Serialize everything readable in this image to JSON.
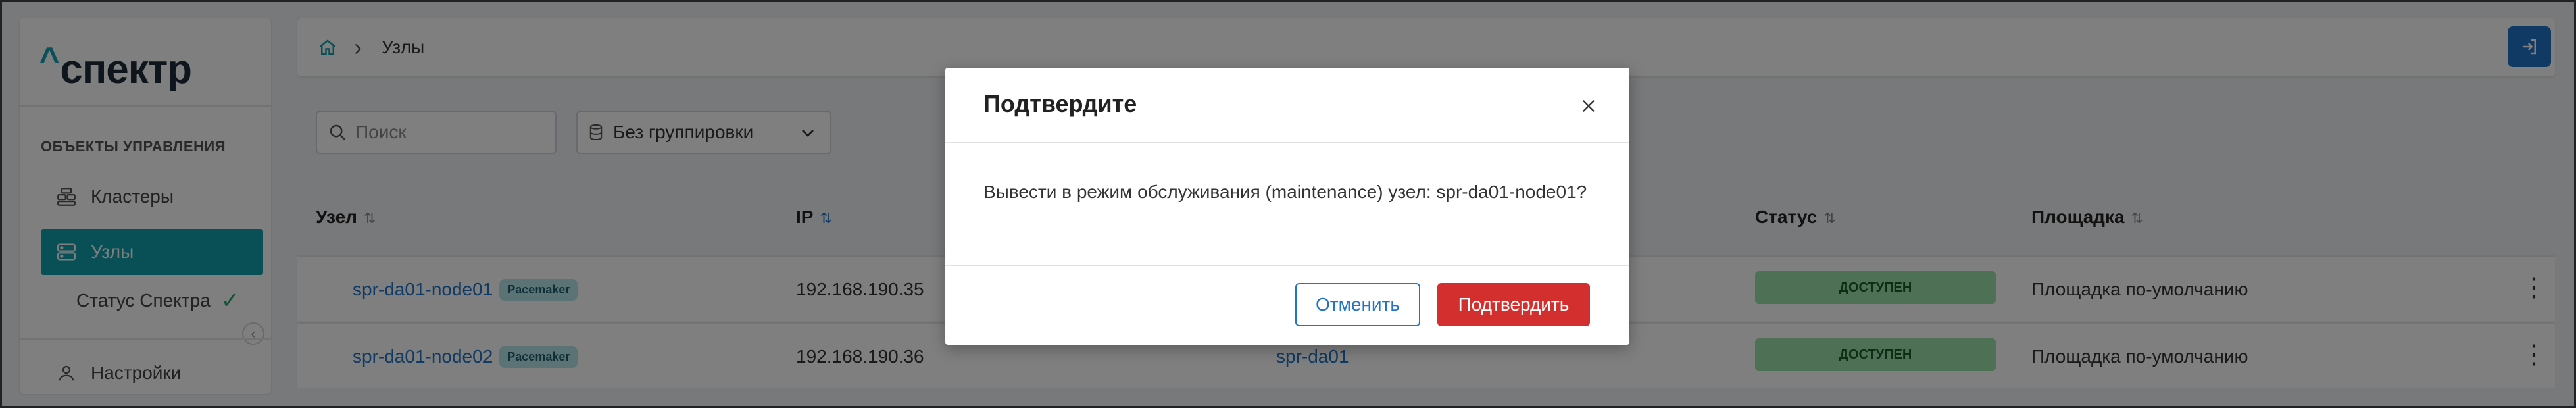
{
  "sidebar": {
    "logo_text": "спектр",
    "logo_caret": "^",
    "section_title": "ОБЪЕКТЫ УПРАВЛЕНИЯ",
    "items": [
      {
        "label": "Кластеры",
        "icon": "stack-icon",
        "active": false
      },
      {
        "label": "Узлы",
        "icon": "server-icon",
        "active": true
      },
      {
        "label": "Статус Спектра",
        "icon": "check-icon",
        "active": false
      },
      {
        "label": "Настройки",
        "icon": "user-icon",
        "active": false
      }
    ]
  },
  "breadcrumb": {
    "home_icon": "home-icon",
    "current": "Узлы"
  },
  "toolbar": {
    "search_placeholder": "Поиск",
    "grouping_value": "Без группировки"
  },
  "table": {
    "columns": [
      "Узел",
      "IP",
      "Статус",
      "Площадка"
    ],
    "rows": [
      {
        "node": "spr-da01-node01",
        "badge": "Pacemaker",
        "ip": "192.168.190.35",
        "cluster": "",
        "status": "ДОСТУПЕН",
        "site": "Площадка по-умолчанию"
      },
      {
        "node": "spr-da01-node02",
        "badge": "Pacemaker",
        "ip": "192.168.190.36",
        "cluster": "spr-da01",
        "status": "ДОСТУПЕН",
        "site": "Площадка по-умолчанию"
      }
    ]
  },
  "modal": {
    "title": "Подтвердите",
    "body": "Вывести в режим обслуживания (maintenance) узел: spr-da01-node01?",
    "cancel_label": "Отменить",
    "confirm_label": "Подтвердить"
  },
  "colors": {
    "accent": "#12a0ad",
    "link": "#2174c7",
    "danger": "#d32f2f",
    "status_ok": "#9de0a8"
  }
}
